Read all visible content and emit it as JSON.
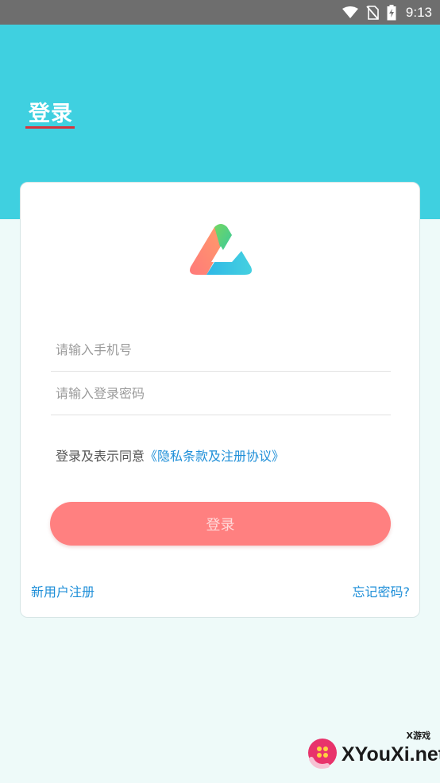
{
  "status_bar": {
    "time": "9:13",
    "icons": [
      "wifi-icon",
      "no-sim-icon",
      "battery-charging-icon"
    ]
  },
  "header": {
    "title": "登录",
    "accent_color": "#3fd0e0",
    "underline_color": "#d9323c"
  },
  "login_form": {
    "logo": "app-logo-triangle",
    "phone_placeholder": "请输入手机号",
    "password_placeholder": "请输入登录密码",
    "agreement_prefix": "登录及表示同意",
    "agreement_link": "《隐私条款及注册协议》",
    "submit_label": "登录",
    "submit_color": "#ff8080",
    "register_link": "新用户注册",
    "forgot_link": "忘记密码?",
    "link_color": "#1f8fd8"
  },
  "watermark": {
    "text": "XYouXi.net",
    "small_text": "X游戏"
  }
}
